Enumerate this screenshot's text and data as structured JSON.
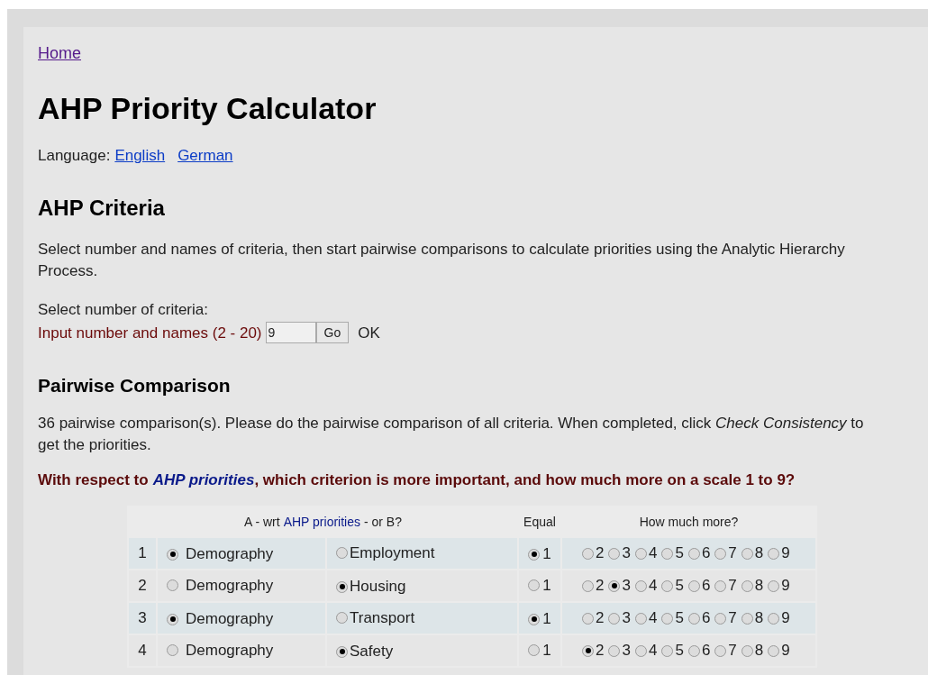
{
  "nav": {
    "home_link": "Home"
  },
  "title": "AHP Priority Calculator",
  "language": {
    "label": "Language:",
    "links": [
      "English",
      "German"
    ]
  },
  "criteria": {
    "heading": "AHP Criteria",
    "description": "Select number and names of criteria, then start pairwise comparisons to calculate priorities using the Analytic Hierarchy Process.",
    "select_label": "Select number of criteria:",
    "input_label": "Input number and names (2 - 20)",
    "input_value": "9",
    "go_button": "Go",
    "status": "OK"
  },
  "pairwise": {
    "heading": "Pairwise Comparison",
    "description": "36 pairwise comparison(s). Please do the pairwise comparison of all criteria. When completed, click *Check Consistency* to get the priorities.",
    "question": {
      "prefix": "With respect to",
      "goal": "AHP priorities",
      "suffix": ", which criterion is more important, and how much more on a scale 1 to 9?"
    },
    "table": {
      "header_ab": {
        "prefix": "A - wrt",
        "goal": "AHP priorities",
        "suffix": "- or B?"
      },
      "header_equal": "Equal",
      "header_more": "How much more?",
      "rows": [
        {
          "number": "1",
          "a": {
            "label": "Demography",
            "selected": true
          },
          "b": {
            "label": "Employment",
            "selected": false
          },
          "scale": [
            {
              "label": "1",
              "selected": true
            },
            {
              "label": "2",
              "selected": false
            },
            {
              "label": "3",
              "selected": false
            },
            {
              "label": "4",
              "selected": false
            },
            {
              "label": "5",
              "selected": false
            },
            {
              "label": "6",
              "selected": false
            },
            {
              "label": "7",
              "selected": false
            },
            {
              "label": "8",
              "selected": false
            },
            {
              "label": "9",
              "selected": false
            }
          ]
        },
        {
          "number": "2",
          "a": {
            "label": "Demography",
            "selected": false
          },
          "b": {
            "label": "Housing",
            "selected": true
          },
          "scale": [
            {
              "label": "1",
              "selected": false
            },
            {
              "label": "2",
              "selected": false
            },
            {
              "label": "3",
              "selected": true
            },
            {
              "label": "4",
              "selected": false
            },
            {
              "label": "5",
              "selected": false
            },
            {
              "label": "6",
              "selected": false
            },
            {
              "label": "7",
              "selected": false
            },
            {
              "label": "8",
              "selected": false
            },
            {
              "label": "9",
              "selected": false
            }
          ]
        },
        {
          "number": "3",
          "a": {
            "label": "Demography",
            "selected": true
          },
          "b": {
            "label": "Transport",
            "selected": false
          },
          "scale": [
            {
              "label": "1",
              "selected": true
            },
            {
              "label": "2",
              "selected": false
            },
            {
              "label": "3",
              "selected": false
            },
            {
              "label": "4",
              "selected": false
            },
            {
              "label": "5",
              "selected": false
            },
            {
              "label": "6",
              "selected": false
            },
            {
              "label": "7",
              "selected": false
            },
            {
              "label": "8",
              "selected": false
            },
            {
              "label": "9",
              "selected": false
            }
          ]
        },
        {
          "number": "4",
          "a": {
            "label": "Demography",
            "selected": false
          },
          "b": {
            "label": "Safety",
            "selected": true
          },
          "scale": [
            {
              "label": "1",
              "selected": false
            },
            {
              "label": "2",
              "selected": true
            },
            {
              "label": "3",
              "selected": false
            },
            {
              "label": "4",
              "selected": false
            },
            {
              "label": "5",
              "selected": false
            },
            {
              "label": "6",
              "selected": false
            },
            {
              "label": "7",
              "selected": false
            },
            {
              "label": "8",
              "selected": false
            },
            {
              "label": "9",
              "selected": false
            }
          ]
        }
      ]
    }
  }
}
